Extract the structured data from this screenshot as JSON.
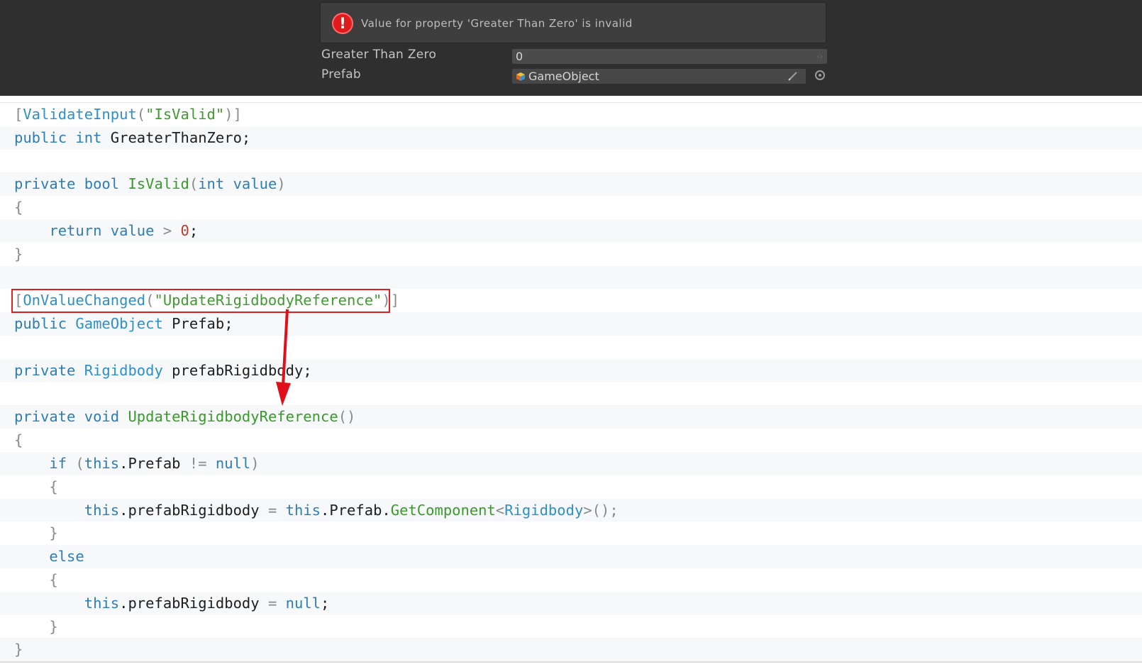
{
  "inspector": {
    "error_message": "Value for property 'Greater Than Zero' is invalid",
    "error_icon": "exclamation-icon",
    "properties": [
      {
        "label": "Greater Than Zero",
        "value": "0"
      },
      {
        "label": "Prefab",
        "value": "GameObject"
      }
    ],
    "icons": [
      "gameobject-cube-icon",
      "pencil-edit-icon",
      "object-picker-icon"
    ]
  },
  "code": {
    "lines": [
      [
        [
          "op",
          "["
        ],
        [
          "attr",
          "ValidateInput"
        ],
        [
          "op",
          "("
        ],
        [
          "str",
          "\"IsValid\""
        ],
        [
          "op",
          ")]"
        ]
      ],
      [
        [
          "kw",
          "public"
        ],
        [
          "t",
          " "
        ],
        [
          "kw",
          "int"
        ],
        [
          "t",
          " GreaterThanZero;"
        ]
      ],
      [],
      [
        [
          "kw",
          "private"
        ],
        [
          "t",
          " "
        ],
        [
          "kw",
          "bool"
        ],
        [
          "t",
          " "
        ],
        [
          "fn",
          "IsValid"
        ],
        [
          "op",
          "("
        ],
        [
          "kw",
          "int"
        ],
        [
          "t",
          " "
        ],
        [
          "kw",
          "value"
        ],
        [
          "op",
          ")"
        ]
      ],
      [
        [
          "op",
          "{"
        ]
      ],
      [
        [
          "t",
          "    "
        ],
        [
          "kw",
          "return"
        ],
        [
          "t",
          " "
        ],
        [
          "kw",
          "value"
        ],
        [
          "t",
          " "
        ],
        [
          "op",
          ">"
        ],
        [
          "t",
          " "
        ],
        [
          "num",
          "0"
        ],
        [
          "t",
          ";"
        ]
      ],
      [
        [
          "op",
          "}"
        ]
      ],
      [],
      [
        [
          "op",
          "["
        ],
        [
          "attr",
          "OnValueChanged"
        ],
        [
          "op",
          "("
        ],
        [
          "str",
          "\"UpdateRigidbodyReference\""
        ],
        [
          "op",
          ")]"
        ]
      ],
      [
        [
          "kw",
          "public"
        ],
        [
          "t",
          " "
        ],
        [
          "typ",
          "GameObject"
        ],
        [
          "t",
          " Prefab;"
        ]
      ],
      [],
      [
        [
          "kw",
          "private"
        ],
        [
          "t",
          " "
        ],
        [
          "typ",
          "Rigidbody"
        ],
        [
          "t",
          " prefabRigidbody;"
        ]
      ],
      [],
      [
        [
          "kw",
          "private"
        ],
        [
          "t",
          " "
        ],
        [
          "kw",
          "void"
        ],
        [
          "t",
          " "
        ],
        [
          "fn",
          "UpdateRigidbodyReference"
        ],
        [
          "op",
          "()"
        ]
      ],
      [
        [
          "op",
          "{"
        ]
      ],
      [
        [
          "t",
          "    "
        ],
        [
          "kw",
          "if"
        ],
        [
          "t",
          " "
        ],
        [
          "op",
          "("
        ],
        [
          "kw",
          "this"
        ],
        [
          "t",
          ".Prefab "
        ],
        [
          "op",
          "!="
        ],
        [
          "t",
          " "
        ],
        [
          "kw",
          "null"
        ],
        [
          "op",
          ")"
        ]
      ],
      [
        [
          "t",
          "    "
        ],
        [
          "op",
          "{"
        ]
      ],
      [
        [
          "t",
          "        "
        ],
        [
          "kw",
          "this"
        ],
        [
          "t",
          ".prefabRigidbody "
        ],
        [
          "op",
          "="
        ],
        [
          "t",
          " "
        ],
        [
          "kw",
          "this"
        ],
        [
          "t",
          ".Prefab."
        ],
        [
          "fn",
          "GetComponent"
        ],
        [
          "op",
          "<"
        ],
        [
          "typ",
          "Rigidbody"
        ],
        [
          "op",
          ">();"
        ]
      ],
      [
        [
          "t",
          "    "
        ],
        [
          "op",
          "}"
        ]
      ],
      [
        [
          "t",
          "    "
        ],
        [
          "kw",
          "else"
        ]
      ],
      [
        [
          "t",
          "    "
        ],
        [
          "op",
          "{"
        ]
      ],
      [
        [
          "t",
          "        "
        ],
        [
          "kw",
          "this"
        ],
        [
          "t",
          ".prefabRigidbody "
        ],
        [
          "op",
          "="
        ],
        [
          "t",
          " "
        ],
        [
          "kw",
          "null"
        ],
        [
          "t",
          ";"
        ]
      ],
      [
        [
          "t",
          "    "
        ],
        [
          "op",
          "}"
        ]
      ],
      [
        [
          "op",
          "}"
        ]
      ]
    ]
  },
  "annotation": {
    "highlight_color": "#e02020",
    "arrow_color": "#e0101a"
  }
}
